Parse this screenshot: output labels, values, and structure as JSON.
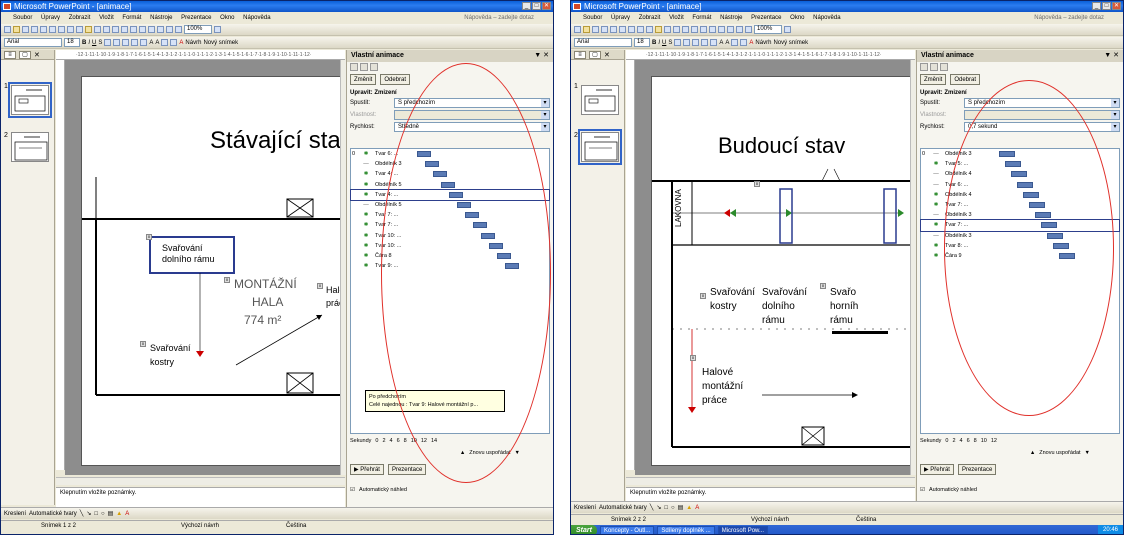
{
  "common": {
    "menu": [
      "Soubor",
      "Úpravy",
      "Zobrazit",
      "Vložit",
      "Formát",
      "Nástroje",
      "Prezentace",
      "Okno",
      "Nápověda"
    ],
    "help_placeholder": "Nápověda – zadejte dotaz",
    "font_name": "Arial",
    "font_size": "18",
    "zoom": "100%",
    "new_slide": "Nový snímek",
    "design": "Návrh",
    "notes_placeholder": "Klepnutím vložíte poznámky.",
    "draw_label": "Kreslení",
    "autoshapes_label": "Automatické tvary",
    "status_design": "Výchozí návrh",
    "status_lang": "Čeština",
    "task_pane_title": "Vlastní animace",
    "change_button": "Změnit",
    "remove_button": "Odebrat",
    "start_label": "Spustit:",
    "property_label": "Vlastnost:",
    "speed_label": "Rychlost:",
    "start_value": "S předchozím",
    "seconds_label": "Sekundy",
    "reorder_label": "Znovu uspořádat",
    "play_button": "Přehrát",
    "slideshow_button": "Prezentace",
    "autopreview_label": "Automatický náhled",
    "close_x": "✕",
    "minimize": "_",
    "maximize": "□",
    "pane_close": "▼ ✕",
    "tick_labels": [
      "0",
      "2",
      "4",
      "6",
      "8",
      "10",
      "12",
      "14"
    ]
  },
  "left_window": {
    "title": "Microsoft PowerPoint - [animace]",
    "slide_status": "Snímek 1 z 2",
    "modify_label": "Upravit: Zmizení",
    "speed_value": "Středně",
    "slide": {
      "title": "Stávající stav",
      "box_text": "Svařování dolního rámu",
      "hall_text_1": "MONTÁŽNÍ",
      "hall_text_2": "HALA",
      "hall_text_3": "774 m²",
      "right_text_1": "Halov",
      "right_text_2": "práce",
      "bottom_text_1": "Svařování",
      "bottom_text_2": "kostry"
    },
    "anim_items": [
      {
        "idx": "0",
        "icon": "⊕",
        "name": "Tvar 6: ...",
        "star": true
      },
      {
        "idx": "",
        "icon": "⊕",
        "name": "Obdélník 3",
        "star": false
      },
      {
        "idx": "",
        "icon": "⊕",
        "name": "Tvar 4: ...",
        "star": true
      },
      {
        "idx": "",
        "icon": "⊕",
        "name": "Obdélník 5",
        "star": true
      },
      {
        "idx": "",
        "icon": "⊕",
        "name": "Tvar 4: ...",
        "star": true
      },
      {
        "idx": "",
        "icon": "⊕",
        "name": "Obdélník 5",
        "star": false
      },
      {
        "idx": "",
        "icon": "⊕",
        "name": "Tvar 7: ...",
        "star": true
      },
      {
        "idx": "",
        "icon": "⊕",
        "name": "Tvar 7: ...",
        "star": true
      },
      {
        "idx": "",
        "icon": "⊕",
        "name": "Tvar 10: ...",
        "star": true
      },
      {
        "idx": "",
        "icon": "⊕",
        "name": "Tvar 10: ...",
        "star": true
      },
      {
        "idx": "",
        "icon": "⊕",
        "name": "Čára 8",
        "star": true
      },
      {
        "idx": "",
        "icon": "⊕",
        "name": "Tvar 9: ...",
        "star": true
      }
    ],
    "tooltip_line1": "Po předchozím",
    "tooltip_line2": "Celé najednou : Tvar 9: Halové montážní p..."
  },
  "right_window": {
    "title": "Microsoft PowerPoint - [animace]",
    "slide_status": "Snímek 2 z 2",
    "modify_label": "Upravit: Zmizení",
    "speed_value": "0,7 sekund",
    "slide": {
      "title": "Budoucí stav",
      "vertical_label": "LAKOVNA",
      "col1_1": "Svařování",
      "col1_2": "kostry",
      "col2_1": "Svařování",
      "col2_2": "dolního",
      "col2_3": "rámu",
      "col3_1": "Svařo",
      "col3_2": "horníh",
      "col3_3": "rámu",
      "hall_1": "Halové",
      "hall_2": "montážní",
      "hall_3": "práce"
    },
    "anim_items": [
      {
        "idx": "0",
        "name": "Obdélník 3",
        "star": false
      },
      {
        "idx": "",
        "name": "Tvar 5: ...",
        "star": true
      },
      {
        "idx": "",
        "name": "Obdélník 4",
        "star": false
      },
      {
        "idx": "",
        "name": "Tvar 6: ...",
        "star": false
      },
      {
        "idx": "",
        "name": "Obdélník 4",
        "star": true
      },
      {
        "idx": "",
        "name": "Tvar 7: ...",
        "star": true
      },
      {
        "idx": "",
        "name": "Obdélník 3",
        "star": false
      },
      {
        "idx": "",
        "name": "Tvar 7: ...",
        "star": true
      },
      {
        "idx": "",
        "name": "Obdélník 3",
        "star": false
      },
      {
        "idx": "",
        "name": "Tvar 8: ...",
        "star": true
      },
      {
        "idx": "",
        "name": "Čára 9",
        "star": true
      }
    ],
    "taskbar": {
      "start": "Start",
      "apps": [
        "Koncepty - Outl...",
        "Sdílený doplněk ...",
        "Microsoft Pow..."
      ],
      "clock": "20:46"
    }
  }
}
